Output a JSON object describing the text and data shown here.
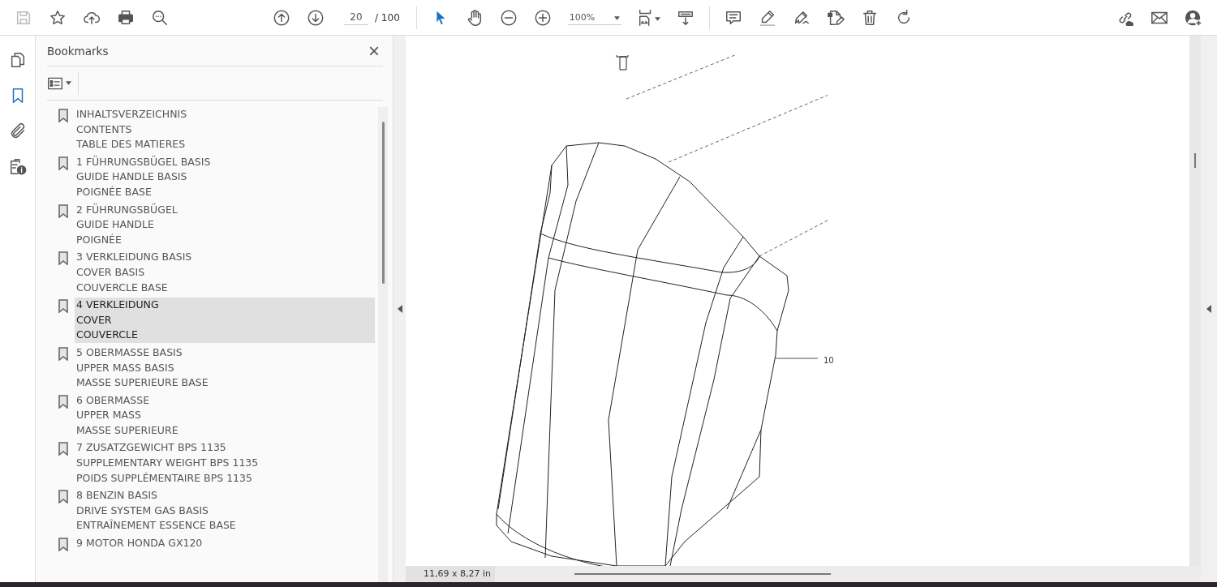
{
  "toolbar": {
    "page_number": "20",
    "page_total": "/ 100",
    "zoom": "100%",
    "tools": [
      {
        "kind": "select",
        "selected": true
      },
      {
        "kind": "hand",
        "selected": false
      }
    ]
  },
  "rail": [
    {
      "kind": "pages",
      "selected": false
    },
    {
      "kind": "bookmarks",
      "selected": true
    },
    {
      "kind": "attachments",
      "selected": false
    },
    {
      "kind": "info",
      "selected": false
    }
  ],
  "bookmarks": {
    "title": "Bookmarks",
    "close": "×",
    "items": [
      {
        "lines": [
          "INHALTSVERZEICHNIS",
          "CONTENTS",
          "TABLE DES MATIERES"
        ],
        "selected": false
      },
      {
        "lines": [
          "1 FÜHRUNGSBÜGEL BASIS",
          "GUIDE HANDLE BASIS",
          "POIGNÉE BASE"
        ],
        "selected": false
      },
      {
        "lines": [
          "2 FÜHRUNGSBÜGEL",
          "GUIDE HANDLE",
          "POIGNÉE"
        ],
        "selected": false
      },
      {
        "lines": [
          "3 VERKLEIDUNG BASIS",
          "COVER BASIS",
          "COUVERCLE BASE"
        ],
        "selected": false
      },
      {
        "lines": [
          "4 VERKLEIDUNG",
          "COVER",
          "COUVERCLE"
        ],
        "selected": true
      },
      {
        "lines": [
          "5 OBERMASSE BASIS",
          "UPPER MASS BASIS",
          "MASSE SUPERIEURE BASE"
        ],
        "selected": false
      },
      {
        "lines": [
          "6 OBERMASSE",
          "UPPER MASS",
          "MASSE SUPERIEURE"
        ],
        "selected": false
      },
      {
        "lines": [
          "7 ZUSATZGEWICHT BPS 1135",
          "SUPPLEMENTARY WEIGHT BPS 1135",
          "POIDS SUPPLÉMENTAIRE BPS 1135"
        ],
        "selected": false
      },
      {
        "lines": [
          "8 BENZIN BASIS",
          "DRIVE SYSTEM GAS BASIS",
          "ENTRAÎNEMENT ESSENCE BASE"
        ],
        "selected": false
      },
      {
        "lines": [
          "9 MOTOR HONDA GX120"
        ],
        "selected": false
      }
    ]
  },
  "document": {
    "callout": "10"
  },
  "status_bar": {
    "page_size": "11,69 x 8,27 in"
  }
}
